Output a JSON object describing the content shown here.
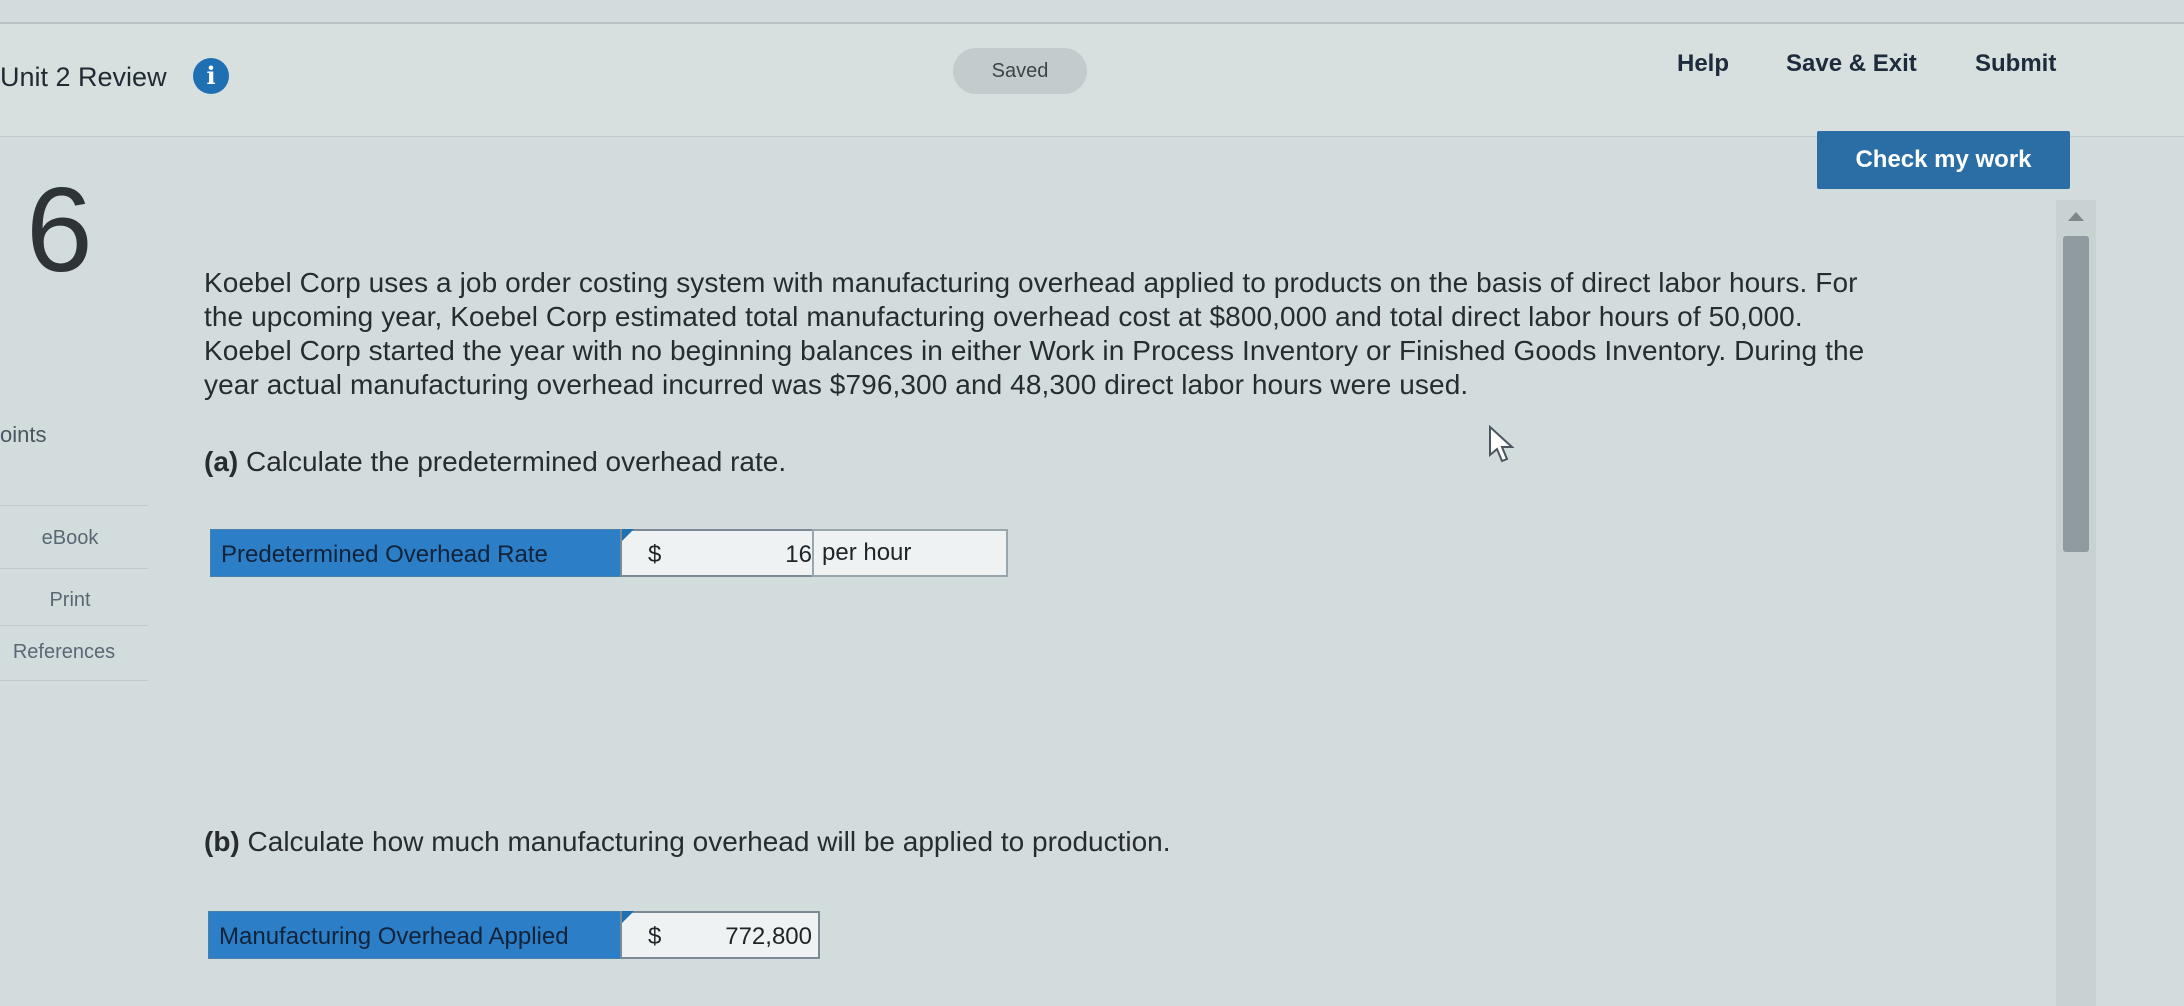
{
  "header": {
    "title": "Unit 2 Review",
    "info_icon": "info-icon",
    "saved_label": "Saved",
    "help_label": "Help",
    "save_exit_label": "Save & Exit",
    "submit_label": "Submit"
  },
  "check_button": "Check my work",
  "question": {
    "number": "6",
    "points_label": "oints"
  },
  "sidebar": {
    "items": [
      {
        "label": "eBook"
      },
      {
        "label": "Print"
      },
      {
        "label": "References"
      }
    ]
  },
  "problem_lines": [
    "Koebel Corp uses a job order costing system with manufacturing overhead applied to products on the basis of direct labor hours. For",
    "the upcoming year, Koebel Corp estimated total manufacturing overhead cost at $800,000 and total direct labor hours of 50,000.",
    "Koebel Corp started the year with no beginning balances in either Work in Process Inventory or Finished Goods Inventory. During the",
    "year actual manufacturing overhead incurred was $796,300 and 48,300 direct labor hours were used."
  ],
  "part_a": {
    "tag": "(a)",
    "prompt": "Calculate the predetermined overhead rate.",
    "label": "Predetermined Overhead Rate",
    "currency": "$",
    "value": "16",
    "unit": "per hour"
  },
  "part_b": {
    "tag": "(b)",
    "prompt": "Calculate how much manufacturing overhead will be applied to production.",
    "label": "Manufacturing Overhead Applied",
    "currency": "$",
    "value": "772,800"
  },
  "colors": {
    "accent": "#2a6ea5",
    "label_fill": "#2c7fc7",
    "background": "#d3dcdc"
  }
}
